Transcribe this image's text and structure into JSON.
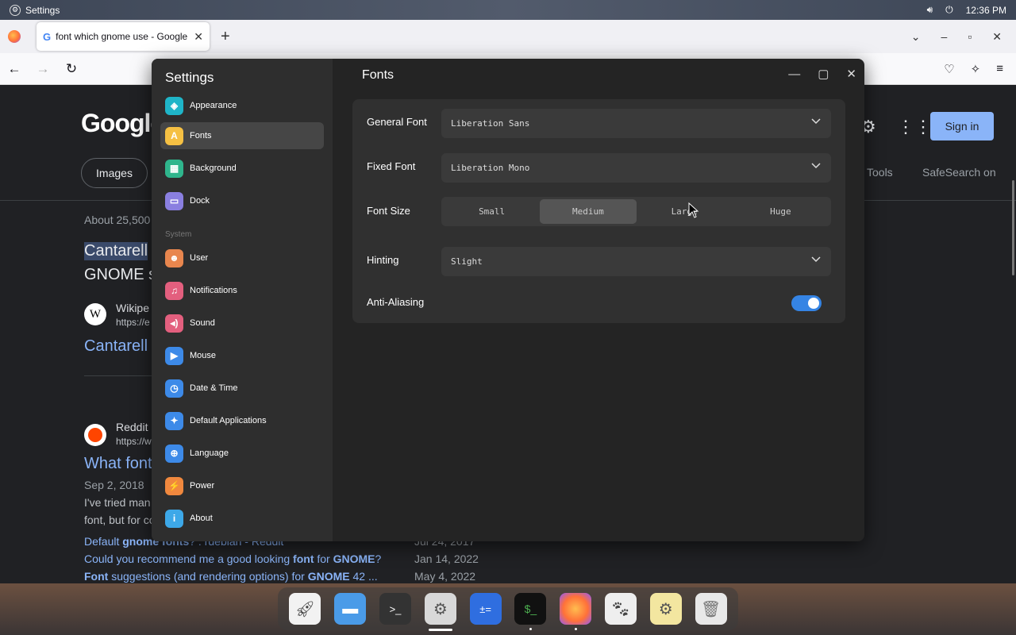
{
  "topbar": {
    "app_name": "Settings",
    "time": "12:36 PM",
    "volume_icon": "speaker-icon",
    "power_icon": "power-icon"
  },
  "browser": {
    "tab_title": "font which gnome use - Google",
    "page": {
      "logo": "Google",
      "chip": "Images",
      "tools": "Tools",
      "safesearch": "SafeSearch on",
      "signin": "Sign in",
      "about": "About 25,500",
      "result1_title": "Cantarell",
      "result1_sub": "GNOME s",
      "wiki_name": "Wikipe",
      "wiki_url": "https://e",
      "result2_title": "Cantarell",
      "reddit_name": "Reddit",
      "reddit_url": "https://w",
      "result3_title": "What font",
      "date": "Sep 2, 2018",
      "snippet1": "I've tried man",
      "snippet2": "font, but for co",
      "links": [
        {
          "pre": "Default ",
          "b1": "gnome fonts",
          "post": "? : rdebian - Reddit",
          "date": "Jul 24, 2017"
        },
        {
          "pre": "Could you recommend me a good looking ",
          "b1": "font",
          "mid": " for ",
          "b2": "GNOME",
          "post": "?",
          "date": "Jan 14, 2022"
        },
        {
          "pre": "",
          "b1": "Font",
          "mid": " suggestions (and rendering options) for ",
          "b2": "GNOME",
          "post": " 42 ...",
          "date": "May 4, 2022"
        }
      ]
    }
  },
  "settings": {
    "sidebar_title": "Settings",
    "section_label": "System",
    "items": [
      {
        "label": "Appearance",
        "color": "#1fb5c8",
        "glyph": "◈"
      },
      {
        "label": "Fonts",
        "color": "#f5c043",
        "glyph": "A"
      },
      {
        "label": "Background",
        "color": "#2fb58c",
        "glyph": "▦"
      },
      {
        "label": "Dock",
        "color": "#8a7fe0",
        "glyph": "▭"
      },
      {
        "label": "User",
        "color": "#e8864e",
        "glyph": "☻"
      },
      {
        "label": "Notifications",
        "color": "#e35f7e",
        "glyph": "♫"
      },
      {
        "label": "Sound",
        "color": "#e35f7e",
        "glyph": "◂)"
      },
      {
        "label": "Mouse",
        "color": "#3d8ae8",
        "glyph": "▶"
      },
      {
        "label": "Date & Time",
        "color": "#3d8ae8",
        "glyph": "◷"
      },
      {
        "label": "Default Applications",
        "color": "#3d8ae8",
        "glyph": "✦"
      },
      {
        "label": "Language",
        "color": "#3d8ae8",
        "glyph": "⊕"
      },
      {
        "label": "Power",
        "color": "#f0883e",
        "glyph": "⚡"
      },
      {
        "label": "About",
        "color": "#3da8e8",
        "glyph": "i"
      }
    ],
    "page_title": "Fonts",
    "general_font_label": "General Font",
    "general_font_value": "Liberation Sans",
    "fixed_font_label": "Fixed Font",
    "fixed_font_value": "Liberation Mono",
    "font_size_label": "Font Size",
    "font_sizes": [
      "Small",
      "Medium",
      "Large",
      "Huge"
    ],
    "hinting_label": "Hinting",
    "hinting_value": "Slight",
    "antialias_label": "Anti-Aliasing"
  }
}
